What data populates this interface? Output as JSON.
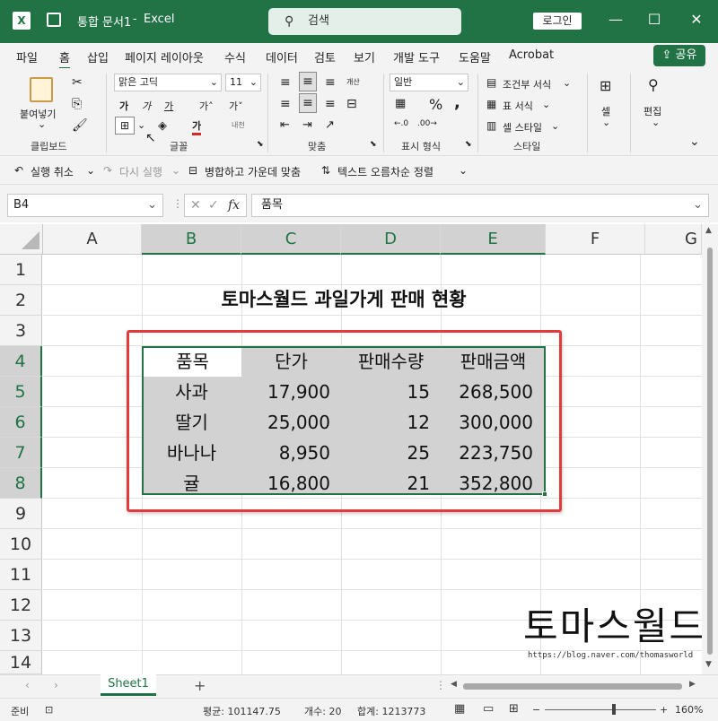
{
  "window": {
    "file_title": "통합 문서1",
    "app": "Excel",
    "search": "검색",
    "login": "로그인",
    "min": "—",
    "max": "☐",
    "close": "✕"
  },
  "menu": {
    "items": [
      "파일",
      "홈",
      "삽입",
      "페이지 레이아웃",
      "수식",
      "데이터",
      "검토",
      "보기",
      "개발 도구",
      "도움말",
      "Acrobat"
    ],
    "share": "공유"
  },
  "ribbon": {
    "paste": "붙여넣기",
    "clipboard": "클립보드",
    "font_name": "맑은 고딕",
    "font_size": "11",
    "font": "글꼴",
    "alignment": "맞춤",
    "number_format": "일반",
    "number": "표시 형식",
    "cond_format": "조건부 서식",
    "table_format": "표 서식",
    "cell_style": "셀 스타일",
    "style": "스타일",
    "cells": "셀",
    "editing": "편집",
    "bold": "가",
    "italic": "가",
    "underline": "가",
    "grow": "가˄",
    "shrink": "가˅",
    "wrap": "개산",
    "phonetic": "내천"
  },
  "qat": {
    "undo": "실행 취소",
    "redo": "다시 실행",
    "merge": "병합하고 가운데 맞춤",
    "sort": "텍스트 오름차순 정렬"
  },
  "formula": {
    "namebox": "B4",
    "fx": "fx",
    "value": "품목"
  },
  "columns": [
    "A",
    "B",
    "C",
    "D",
    "E",
    "F",
    "G"
  ],
  "rows": [
    "1",
    "2",
    "3",
    "4",
    "5",
    "6",
    "7",
    "8",
    "9",
    "10",
    "11",
    "12",
    "13",
    "14"
  ],
  "sheet": {
    "title": "토마스월드 과일가게 판매 현황",
    "headers": [
      "품목",
      "단가",
      "판매수량",
      "판매금액"
    ],
    "data": [
      [
        "사과",
        "17,900",
        "15",
        "268,500"
      ],
      [
        "딸기",
        "25,000",
        "12",
        "300,000"
      ],
      [
        "바나나",
        "8,950",
        "25",
        "223,750"
      ],
      [
        "귤",
        "16,800",
        "21",
        "352,800"
      ]
    ]
  },
  "tabs": {
    "sheet1": "Sheet1",
    "add": "+"
  },
  "status": {
    "ready": "준비",
    "average": "평균: 101147.75",
    "count": "개수: 20",
    "sum": "합계: 1213773",
    "zoom": "160%"
  },
  "watermark": {
    "text": "토마스월드",
    "url": "https://blog.naver.com/thomasworld"
  },
  "colors": {
    "accent": "#217346",
    "highlight": "#e03c3c"
  }
}
